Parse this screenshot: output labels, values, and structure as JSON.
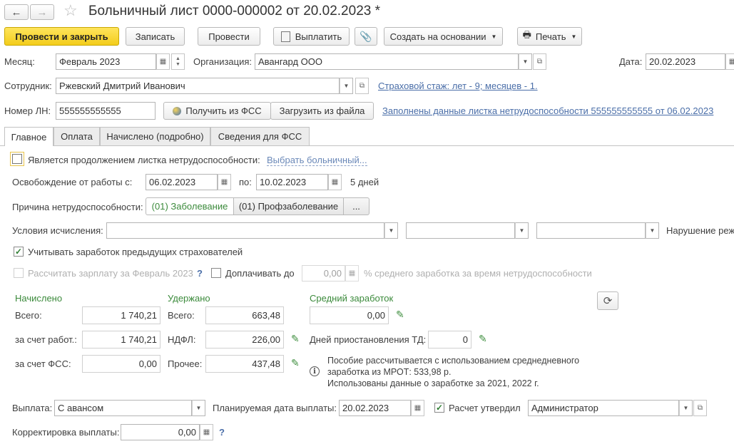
{
  "window": {
    "title": "Больничный лист 0000-000002 от 20.02.2023 *"
  },
  "toolbar": {
    "post_close": "Провести и закрыть",
    "save": "Записать",
    "post": "Провести",
    "pay": "Выплатить",
    "create_based": "Создать на основании",
    "print": "Печать"
  },
  "header": {
    "month_label": "Месяц:",
    "month_value": "Февраль 2023",
    "org_label": "Организация:",
    "org_value": "Авангард ООО",
    "date_label": "Дата:",
    "date_value": "20.02.2023",
    "employee_label": "Сотрудник:",
    "employee_value": "Ржевский Дмитрий Иванович",
    "insurance_link": "Страховой стаж: лет - 9; месяцев - 1.",
    "ln_label": "Номер ЛН:",
    "ln_value": "555555555555",
    "get_fss": "Получить из ФСС",
    "load_file": "Загрузить из файла",
    "filled_link": "Заполнены данные листка нетрудоспособности 555555555555 от 06.02.2023"
  },
  "tabs": [
    "Главное",
    "Оплата",
    "Начислено (подробно)",
    "Сведения для ФСС"
  ],
  "main": {
    "continuation_label": "Является продолжением листка нетрудоспособности:",
    "choose_sick": "Выбрать больничный...",
    "release_label": "Освобождение от работы с:",
    "release_from": "06.02.2023",
    "to_label": "по:",
    "release_to": "10.02.2023",
    "days": "5 дней",
    "reason_label": "Причина нетрудоспособности:",
    "reason_opt1": "(01) Заболевание",
    "reason_opt2": "(01) Профзаболевание",
    "reason_more": "...",
    "conditions_label": "Условия исчисления:",
    "violation_label": "Нарушение реж",
    "consider_prev": "Учитывать заработок предыдущих страхователей",
    "calc_salary": "Рассчитать зарплату за Февраль 2023",
    "question": "?",
    "extra_pay": "Доплачивать до",
    "extra_value": "0,00",
    "extra_suffix": "% среднего заработка за время нетрудоспособности"
  },
  "totals": {
    "accrued_title": "Начислено",
    "total_label": "Всего:",
    "total_value": "1 740,21",
    "employer_label": "за счет работ.:",
    "employer_value": "1 740,21",
    "fss_label": "за счет ФСС:",
    "fss_value": "0,00",
    "withheld_title": "Удержано",
    "withheld_total_label": "Всего:",
    "withheld_total_value": "663,48",
    "ndfl_label": "НДФЛ:",
    "ndfl_value": "226,00",
    "other_label": "Прочее:",
    "other_value": "437,48",
    "avg_title": "Средний заработок",
    "avg_value": "0,00",
    "suspend_label": "Дней приостановления ТД:",
    "suspend_value": "0",
    "info_line1": "Пособие рассчитывается с использованием среднедневного",
    "info_line2": "заработка из МРОТ: 533,98 р.",
    "info_line3": "Использованы данные о заработке за  2021,  2022 г."
  },
  "footer": {
    "payout_label": "Выплата:",
    "payout_value": "С авансом",
    "planned_label": "Планируемая дата выплаты:",
    "planned_value": "20.02.2023",
    "approved_label": "Расчет утвердил",
    "approver_value": "Администратор",
    "correction_label": "Корректировка выплаты:",
    "correction_value": "0,00",
    "question": "?"
  }
}
